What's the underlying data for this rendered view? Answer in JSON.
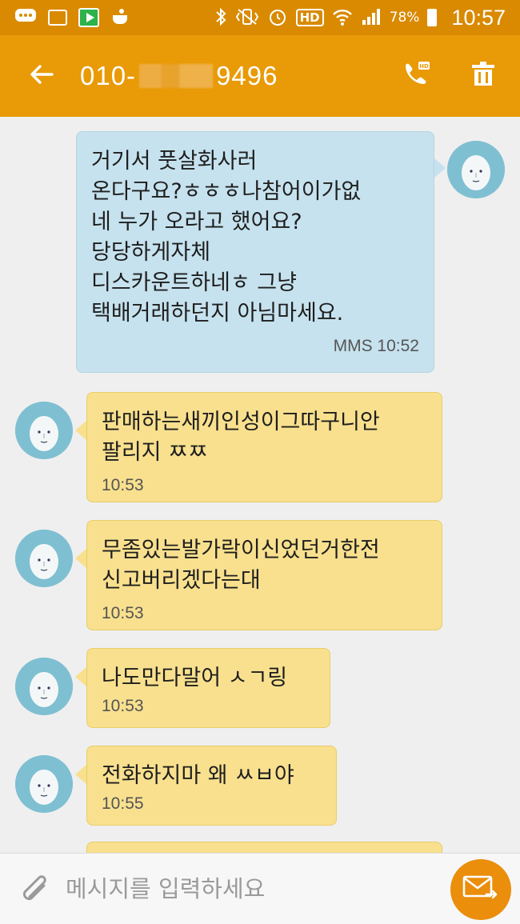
{
  "status_bar": {
    "battery": "78%",
    "time": "10:57",
    "network_label": "HD"
  },
  "header": {
    "phone_prefix": "010-",
    "phone_suffix": "9496",
    "back_icon": "arrow-left-icon",
    "call_icon": "hd-call-icon",
    "delete_icon": "trash-icon"
  },
  "messages": [
    {
      "direction": "out",
      "text": "거기서  풋살화사러\n온다구요?ㅎㅎㅎ나참어이가없\n네 누가 오라고 했어요?\n당당하게자체\n디스카운트하네ㅎ 그냥\n택배거래하던지 아님마세요.",
      "meta": "MMS 10:52"
    },
    {
      "direction": "in",
      "text": "판매하는새끼인성이그따구니안\n팔리지 ㅉㅉ",
      "meta": "10:53"
    },
    {
      "direction": "in",
      "text": "무좀있는발가락이신었던거한전\n신고버리겠다는대",
      "meta": "10:53"
    },
    {
      "direction": "in",
      "text": "나도만다말어 ㅅㄱ링",
      "meta": "10:53"
    },
    {
      "direction": "in",
      "text": "전화하지마 왜 ㅆㅂ야",
      "meta": "10:55"
    }
  ],
  "composer": {
    "placeholder": "메시지를 입력하세요",
    "attach_icon": "paperclip-icon",
    "send_icon": "send-envelope-icon"
  },
  "colors": {
    "status_bar": "#d98a00",
    "app_bar": "#e89a07",
    "bubble_out": "#c6e2ee",
    "bubble_in": "#f8e08e",
    "send_button": "#ea8e0c"
  }
}
